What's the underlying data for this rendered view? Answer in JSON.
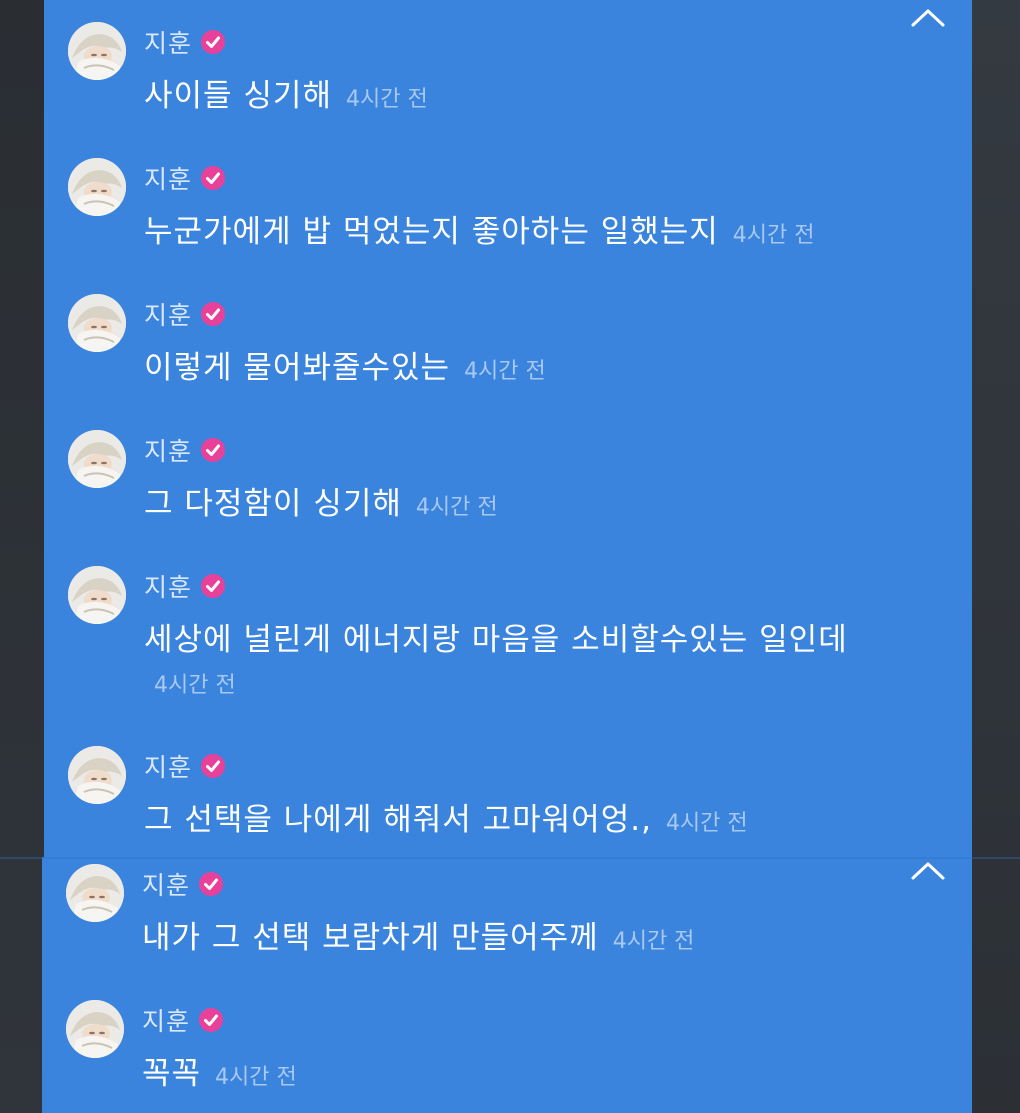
{
  "colors": {
    "panel": "#3a84de",
    "author": "#dbe8f9",
    "message_text": "#ffffff",
    "timestamp": "#a8c8f0",
    "verified_badge": "#e8419a",
    "background": "#2d3136"
  },
  "icons": {
    "collapse": "chevron-up-icon",
    "verified": "verified-badge-icon",
    "avatar": "avatar"
  },
  "messages": [
    {
      "author": "지훈",
      "text": "사이들 싱기해",
      "time": "4시간 전"
    },
    {
      "author": "지훈",
      "text": "누군가에게 밥 먹었는지 좋아하는 일했는지",
      "time": "4시간 전"
    },
    {
      "author": "지훈",
      "text": "이렇게 물어봐줄수있는",
      "time": "4시간 전"
    },
    {
      "author": "지훈",
      "text": "그 다정함이 싱기해",
      "time": "4시간 전"
    },
    {
      "author": "지훈",
      "text": "세상에 널린게 에너지랑 마음을 소비할수있는 일인데",
      "time": "4시간 전"
    },
    {
      "author": "지훈",
      "text": "그 선택을 나에게 해줘서 고마워어엉.,",
      "time": "4시간 전"
    },
    {
      "author": "지훈",
      "text": "내가 그 선택 보람차게 만들어주께",
      "time": "4시간 전"
    },
    {
      "author": "지훈",
      "text": "꼭꼭",
      "time": "4시간 전"
    }
  ]
}
